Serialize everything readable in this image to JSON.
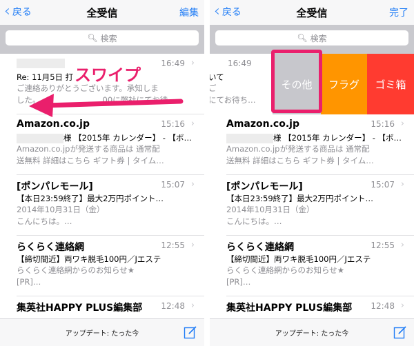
{
  "nav": {
    "back_label": "戻る",
    "title": "全受信",
    "edit_label": "編集",
    "done_label": "完了"
  },
  "search": {
    "placeholder": "検索"
  },
  "annotation": {
    "swipe": "スワイプ"
  },
  "swipe_actions": {
    "other": "その他",
    "flag": "フラグ",
    "trash": "ゴミ箱"
  },
  "messages": [
    {
      "sender": "",
      "time": "16:49",
      "subject": "Re: 11月5日 打",
      "preview1": "ご連絡ありがとうございます。承知しま",
      "preview2": "した。",
      "preview2_tail": "00に弊社にてお待",
      "right_preview0": "いて",
      "right_preview1": "ご",
      "right_preview2": "にてお待ち…"
    },
    {
      "sender": "Amazon.co.jp",
      "time": "15:16",
      "subject": "様 【2015年 カレンダー】 - 【ボ…",
      "preview1": "Amazon.co.jpが発送する商品は 通常配",
      "preview2": "送無料 詳細はこちら ギフト券 | タイム…"
    },
    {
      "sender": "[ポンパレモール]",
      "time": "15:07",
      "subject": "【本日23:59終了】最大2万円ポイント…",
      "preview1": "2014年10月31日（金）",
      "preview2": "こんにちは。…"
    },
    {
      "sender": "らくらく連絡網",
      "time": "12:55",
      "subject": "【締切間近】両ワキ脱毛100円／Jエステ",
      "preview1": "らくらく連絡網からのお知らせ★",
      "preview2": "[PR]…"
    },
    {
      "sender": "集英社HAPPY PLUS編集部",
      "time": "12:48",
      "subject": "",
      "preview1": "",
      "preview2": ""
    }
  ],
  "toolbar": {
    "update_text": "アップデート: たった今"
  },
  "colors": {
    "ios_blue": "#1f7cf6",
    "highlight": "#ea1f6c",
    "flag": "#ff9500",
    "trash": "#ff3b30",
    "other": "#c7c7cc"
  },
  "icons": {
    "back": "chevron-left-icon",
    "search": "magnifier-icon",
    "compose": "compose-icon",
    "row": "chevron-right-icon"
  }
}
